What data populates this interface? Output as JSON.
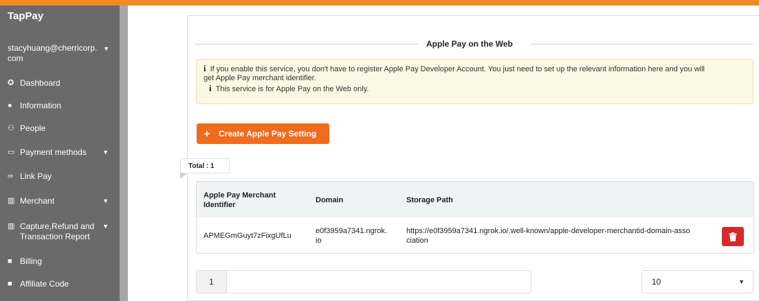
{
  "brand": "TapPay",
  "user": {
    "email_line1": "stacyhuang@cherricorp.",
    "email_line2": "com"
  },
  "sidebar": {
    "items": [
      {
        "icon": "dashboard-icon",
        "glyph": "✪",
        "label": "Dashboard"
      },
      {
        "icon": "info-icon",
        "glyph": "●",
        "label": "Information"
      },
      {
        "icon": "people-icon",
        "glyph": "⚇",
        "label": "People"
      },
      {
        "icon": "card-icon",
        "glyph": "▭",
        "label": "Payment methods"
      },
      {
        "icon": "link-icon",
        "glyph": "∞",
        "label": "Link Pay"
      },
      {
        "icon": "merchant-icon",
        "glyph": "▥",
        "label": "Merchant"
      },
      {
        "icon": "report-icon",
        "glyph": "▥",
        "label_line1": "Capture,Refund and",
        "label_line2": "Transaction Report"
      },
      {
        "icon": "billing-icon",
        "glyph": "■",
        "label": "Billing"
      },
      {
        "icon": "affiliate-icon",
        "glyph": "■",
        "label": "Affiliate Code"
      }
    ]
  },
  "section": {
    "title": "Apple Pay on the Web"
  },
  "notice": {
    "line1": "If you enable this service, you don't have to register Apple Pay Developer Account. You just need to set up the relevant information here and you will",
    "line1b": "get Apple Pay merchant identifier.",
    "line2": "This service is for Apple Pay on the Web only."
  },
  "create_button": {
    "label": "Create Apple Pay Setting"
  },
  "total": "Total : 1",
  "table": {
    "headers": {
      "identifier_line1": "Apple Pay Merchant",
      "identifier_line2": "Identifier",
      "domain": "Domain",
      "storage_path": "Storage Path"
    },
    "rows": [
      {
        "identifier": "APMEGmGuyt7zFixgUfLu",
        "domain_line1": "e0f3959a7341.ngrok.",
        "domain_line2": "io",
        "path_line1": "https://e0f3959a7341.ngrok.io/.well-known/apple-developer-merchantid-domain-asso",
        "path_line2": "ciation"
      }
    ]
  },
  "pager": {
    "page": "1"
  },
  "page_size": {
    "value": "10"
  },
  "colors": {
    "accent": "#f06b1e",
    "topbar": "#f08a24",
    "danger": "#d42a2a",
    "sidebar": "#6a6a6a"
  }
}
